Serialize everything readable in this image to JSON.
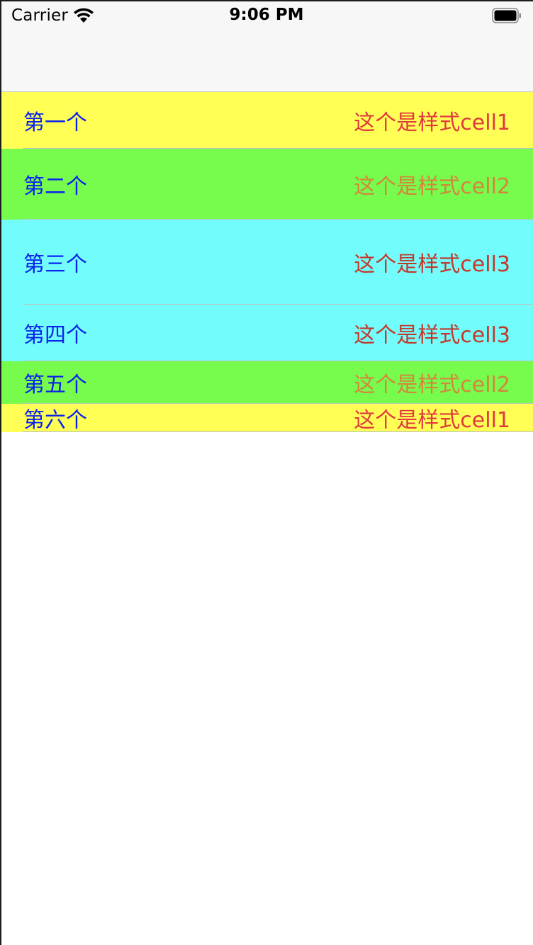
{
  "status_bar": {
    "carrier": "Carrier",
    "time": "9:06 PM",
    "wifi_icon": "wifi-icon",
    "battery_icon": "battery-icon"
  },
  "colors": {
    "yellow": "#ffff55",
    "green": "#77fb4c",
    "cyan": "#73fcfc",
    "title_blue": "#0a22ee",
    "detail_red": "#e0393e",
    "detail_orange": "#d2873c",
    "detail_darkred": "#c0392b"
  },
  "rows": [
    {
      "title": "第一个",
      "detail": "这个是样式cell1",
      "style": "cell1"
    },
    {
      "title": "第二个",
      "detail": "这个是样式cell2",
      "style": "cell2"
    },
    {
      "title": "第三个",
      "detail": "这个是样式cell3",
      "style": "cell3"
    },
    {
      "title": "第四个",
      "detail": "这个是样式cell3",
      "style": "cell3"
    },
    {
      "title": "第五个",
      "detail": "这个是样式cell2",
      "style": "cell2"
    },
    {
      "title": "第六个",
      "detail": "这个是样式cell1",
      "style": "cell1"
    }
  ]
}
